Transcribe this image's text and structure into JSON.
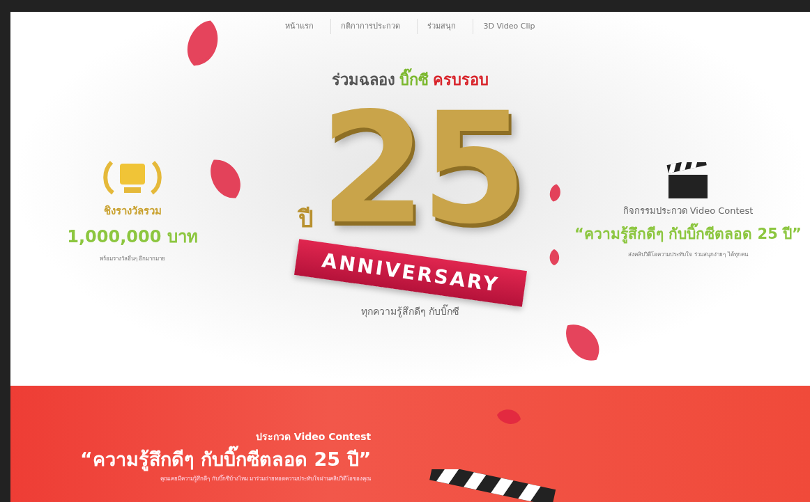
{
  "nav": [
    {
      "label": "หน้าแรก"
    },
    {
      "label": "กติกาการประกวด"
    },
    {
      "label": "ร่วมสนุก"
    },
    {
      "label": "3D Video Clip"
    }
  ],
  "hero": {
    "heading": [
      {
        "text": "ร่วมฉลอง",
        "color": "#555555"
      },
      {
        "text": "บิ๊กซี",
        "color": "#7cb82f"
      },
      {
        "text": "ครบรอบ",
        "color": "#d8232a"
      }
    ],
    "number": "25",
    "unit": "ปี",
    "ribbon": "ANNIVERSARY",
    "tagline": "ทุกความรู้สึกดีๆ กับบิ๊กซี"
  },
  "contest": {
    "title": "กิจกรรมประกวด Video Contest",
    "quote": "“ความรู้สึกดีๆ กับบิ๊กซีตลอด 25 ปี”",
    "note": "ส่งคลิปวิดีโอความประทับใจ ร่วมสนุกง่ายๆ ได้ทุกคน"
  },
  "prize": {
    "title": "ชิงรางวัลรวม",
    "amount": "1,000,000 บาท",
    "note": "พร้อมรางวัลอื่นๆ อีกมากมาย"
  },
  "section": {
    "title": "ประกวด Video Contest",
    "quote": "“ความรู้สึกดีๆ กับบิ๊กซีตลอด 25 ปี”",
    "body": "คุณเคยมีความรู้สึกดีๆ กับบิ๊กซีบ้างไหม มาร่วมถ่ายทอดความประทับใจผ่านคลิปวิดีโอของคุณ"
  }
}
